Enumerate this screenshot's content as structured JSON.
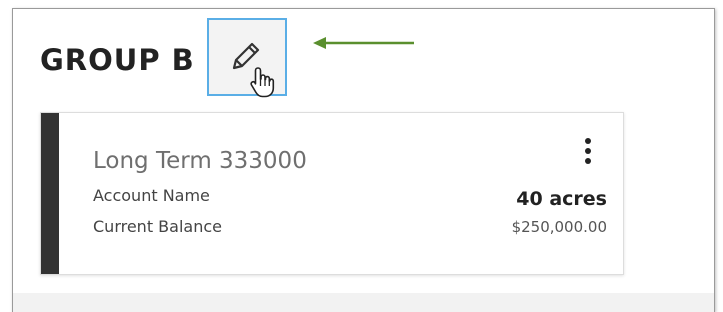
{
  "group": {
    "title": "GROUP B",
    "edit_icon": "pencil-icon",
    "cursor_icon": "hand-pointer-icon"
  },
  "annotation": {
    "arrow_icon": "arrow-left-icon",
    "color": "#5a8f2e"
  },
  "card": {
    "title": "Long Term 333000",
    "account_name_label": "Account Name",
    "current_balance_label": "Current Balance",
    "acreage": "40 acres",
    "balance": "$250,000.00",
    "menu_icon": "kebab-menu-icon",
    "accent_color": "#333333"
  },
  "colors": {
    "edit_border": "#5aaee6",
    "edit_background": "#f3f3f3"
  }
}
